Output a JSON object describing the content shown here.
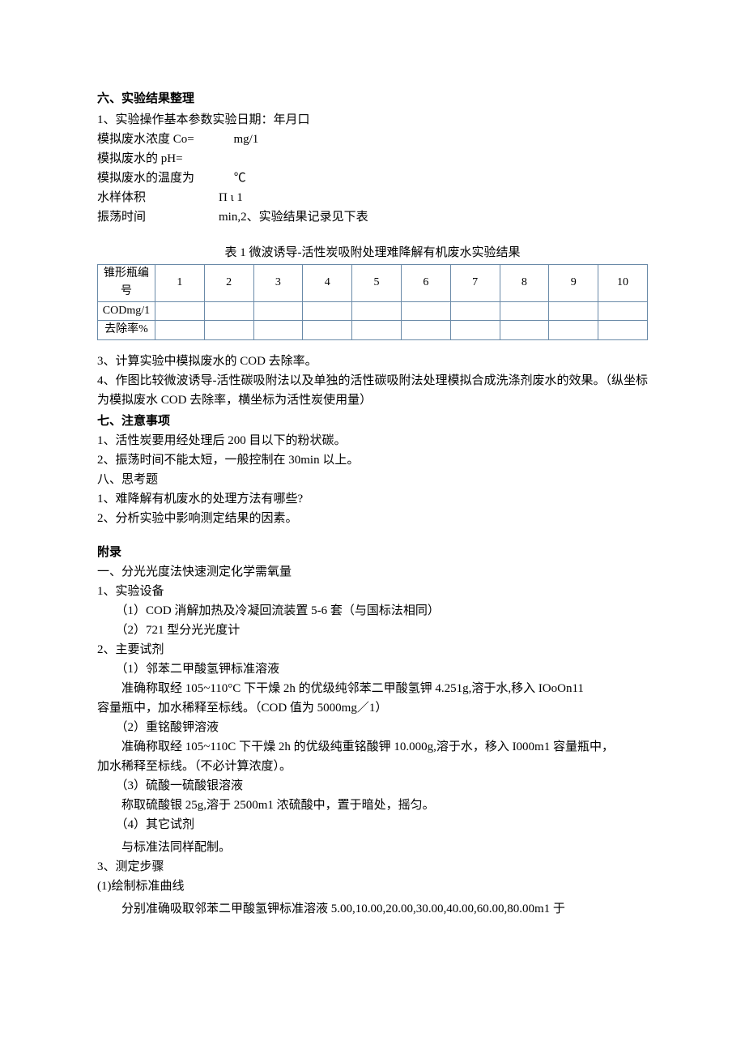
{
  "section6": {
    "title": "六、实验结果整理",
    "paramIntro": "1、实验操作基本参数实验日期：年月口",
    "line_co": "模拟废水浓度 Co=             mg/1",
    "line_ph": "模拟废水的 pH=",
    "line_temp": "模拟废水的温度为             ℃",
    "line_vol": "水样体积                        Π ι 1",
    "line_shake": "振荡时间                        min,2、实验结果记录见下表",
    "tableTitle": "表 1 微波诱导-活性炭吸附处理难降解有机废水实验结果",
    "table": {
      "header": "锥形瓶编号",
      "cols": [
        "1",
        "2",
        "3",
        "4",
        "5",
        "6",
        "7",
        "8",
        "9",
        "10"
      ],
      "row1": "CODmg/1",
      "row2": "去除率%"
    },
    "item3": "3、计算实验中模拟废水的 COD 去除率。",
    "item4": "4、作图比较微波诱导-活性碳吸附法以及单独的活性碳吸附法处理模拟合成洗涤剂废水的效果。（纵坐标为模拟废水 COD 去除率，横坐标为活性炭使用量）"
  },
  "section7": {
    "title": "七、注意事项",
    "item1": "1、活性炭要用经处理后 200 目以下的粉状碳。",
    "item2": "2、振荡时间不能太短，一般控制在 30min 以上。"
  },
  "section8": {
    "title": "八、思考题",
    "item1": "1、难降解有机废水的处理方法有哪些?",
    "item2": "2、分析实验中影响测定结果的因素。"
  },
  "appendix": {
    "title": "附录",
    "a1": "一、分光光度法快速测定化学需氧量",
    "s1": {
      "title": "1、实验设备",
      "i1": "（1）COD 消解加热及冷凝回流装置 5-6 套（与国标法相同）",
      "i2": "（2）721 型分光光度计"
    },
    "s2": {
      "title": "2、主要试剂",
      "r1t": "（1）邻苯二甲酸氢钾标准溶液",
      "r1d": "准确称取经 105~110°C 下干燥 2h 的优级纯邻苯二甲酸氢钾 4.251g,溶于水,移入 IOoOn11",
      "r1d2": "容量瓶中，加水稀释至标线。（COD 值为 5000mg／1）",
      "r2t": "（2）重铭酸钾溶液",
      "r2d": "准确称取经 105~110C 下干燥 2h 的优级纯重铭酸钾 10.000g,溶于水，移入 I000m1 容量瓶中，",
      "r2d2": "加水稀释至标线。（不必计算浓度）。",
      "r3t": "（3）硫酸一硫酸银溶液",
      "r3d": "称取硫酸银 25g,溶于 2500m1 浓硫酸中，置于暗处，摇匀。",
      "r4t": "（4）其它试剂",
      "r4d": "与标准法同样配制。"
    },
    "s3": {
      "title": "3、测定步骤",
      "i1t": "(1)绘制标准曲线",
      "i1d": "分别准确吸取邻苯二甲酸氢钾标准溶液 5.00,10.00,20.00,30.00,40.00,60.00,80.00m1 于"
    }
  }
}
